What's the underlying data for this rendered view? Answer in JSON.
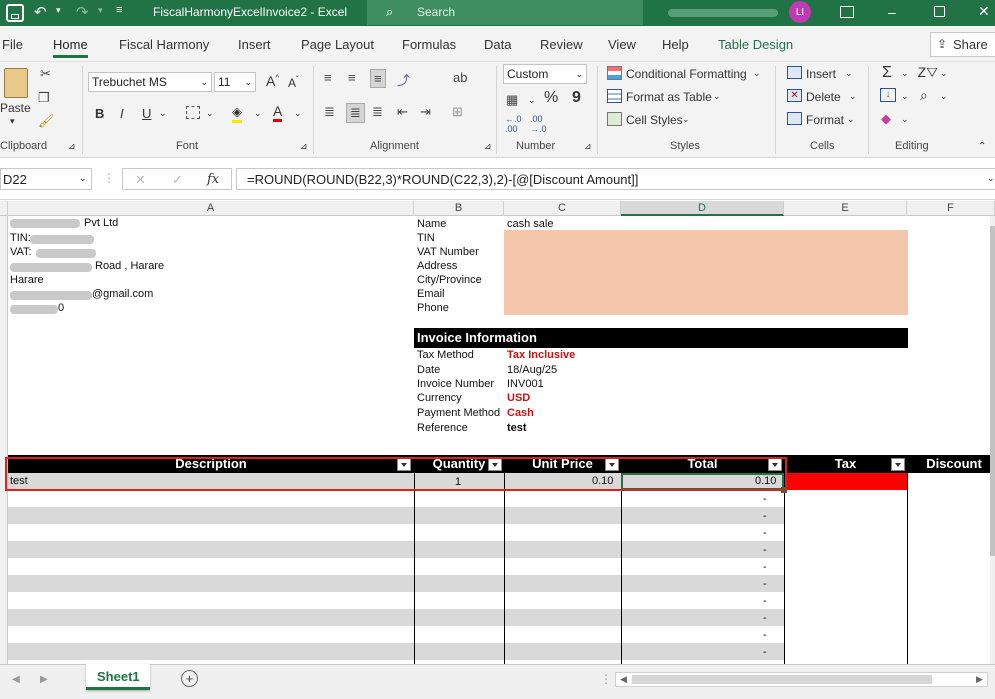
{
  "title_bar": {
    "doc_title": "FiscalHarmonyExcelInvoice2  -  Excel",
    "search_placeholder": "Search",
    "user_initials": "LI"
  },
  "menu": [
    "File",
    "Home",
    "Fiscal Harmony",
    "Insert",
    "Page Layout",
    "Formulas",
    "Data",
    "Review",
    "View",
    "Help",
    "Table Design"
  ],
  "share_label": "Share",
  "ribbon": {
    "clipboard": {
      "paste": "Paste",
      "group": "Clipboard"
    },
    "font": {
      "name": "Trebuchet MS",
      "size": "11",
      "bold": "B",
      "italic": "I",
      "underline": "U",
      "group": "Font"
    },
    "alignment": {
      "group": "Alignment"
    },
    "number": {
      "format": "Custom",
      "percent": "%",
      "comma": "9",
      "group": "Number"
    },
    "styles": {
      "conditional": "Conditional Formatting",
      "format_table": "Format as Table",
      "cell_styles": "Cell Styles",
      "group": "Styles"
    },
    "cells": {
      "insert": "Insert",
      "delete": "Delete",
      "format": "Format",
      "group": "Cells"
    },
    "editing": {
      "group": "Editing"
    }
  },
  "formula_bar": {
    "name_box": "D22",
    "formula": "=ROUND(ROUND(B22,3)*ROUND(C22,3),2)-[@[Discount Amount]]",
    "fx": "fx"
  },
  "columns": [
    "A",
    "B",
    "C",
    "D",
    "E",
    "F"
  ],
  "company": {
    "name_suffix": "Pvt Ltd",
    "tin_label": "TIN:",
    "vat_label": "VAT:",
    "road": "Road , Harare",
    "city": "Harare",
    "email_suffix": "@gmail.com",
    "phone_fragment": "0"
  },
  "customer": {
    "labels": [
      "Name",
      "TIN",
      "VAT Number",
      "Address",
      "City/Province",
      "Email",
      "Phone"
    ],
    "name_value": "cash sale"
  },
  "invoice_info": {
    "header": "Invoice Information",
    "tax_method_label": "Tax Method",
    "tax_method": "Tax Inclusive",
    "date_label": "Date",
    "date": "18/Aug/25",
    "invoice_number_label": "Invoice Number",
    "invoice_number": "INV001",
    "currency_label": "Currency",
    "currency": "USD",
    "payment_label": "Payment Method",
    "payment": "Cash",
    "reference_label": "Reference",
    "reference": "test"
  },
  "table": {
    "headers": [
      "Description",
      "Quantity",
      "Unit Price",
      "Total",
      "Tax",
      "Discount"
    ],
    "row": {
      "description": "test",
      "quantity": "1",
      "unit_price": "0.10",
      "total": "0.10"
    },
    "empty_marker": "-"
  },
  "sheet_tab": "Sheet1",
  "colors": {
    "excel_green": "#217346",
    "peach": "#f4c7ac",
    "red_cell": "#ff0000",
    "highlight_border": "#e02020"
  }
}
